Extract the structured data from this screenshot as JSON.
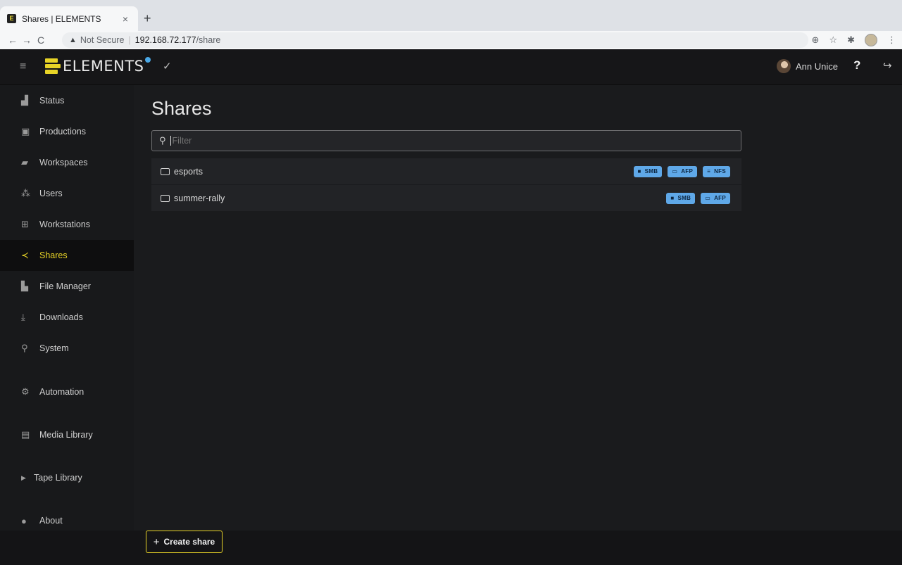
{
  "browser": {
    "tab_title": "Shares | ELEMENTS",
    "tab_close": "×",
    "new_tab": "+",
    "not_secure": "Not Secure",
    "url_host": "192.168.72.177",
    "url_path": "/share"
  },
  "header": {
    "logo_text": "ELEMENTS",
    "user_name": "Ann Unice",
    "help_label": "?"
  },
  "sidebar": {
    "items": [
      {
        "label": "Status",
        "icon": "chart-icon"
      },
      {
        "label": "Productions",
        "icon": "briefcase-icon"
      },
      {
        "label": "Workspaces",
        "icon": "folder-open-icon"
      },
      {
        "label": "Users",
        "icon": "users-icon"
      },
      {
        "label": "Workstations",
        "icon": "network-icon"
      },
      {
        "label": "Shares",
        "icon": "share-icon",
        "active": true
      },
      {
        "label": "File Manager",
        "icon": "files-icon"
      },
      {
        "label": "Downloads",
        "icon": "download-icon"
      },
      {
        "label": "System",
        "icon": "wrench-icon"
      },
      {
        "label": "Automation",
        "icon": "cogs-icon"
      },
      {
        "label": "Media Library",
        "icon": "film-icon"
      },
      {
        "label": "Tape Library",
        "icon": "caret-right-icon"
      },
      {
        "label": "About",
        "icon": "info-icon"
      }
    ]
  },
  "main": {
    "title": "Shares",
    "filter_placeholder": "Filter",
    "shares": [
      {
        "name": "esports",
        "protocols": [
          "SMB",
          "AFP",
          "NFS"
        ]
      },
      {
        "name": "summer-rally",
        "protocols": [
          "SMB",
          "AFP"
        ]
      }
    ]
  },
  "footer": {
    "create_label": "Create share"
  },
  "colors": {
    "accent": "#e8d427",
    "badge": "#5fa8e8",
    "background": "#1a1b1d"
  }
}
